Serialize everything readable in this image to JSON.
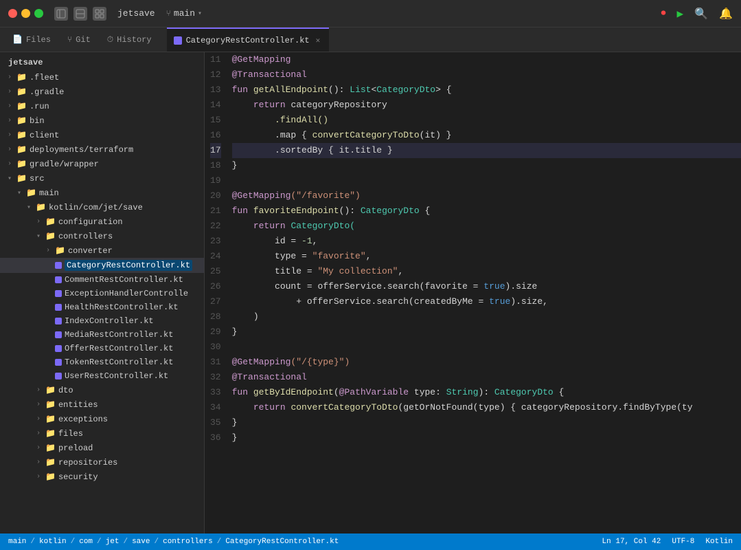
{
  "titlebar": {
    "brand": "jetsave",
    "branch_icon": "⑂",
    "branch": "main",
    "branch_arrow": "▾"
  },
  "tabs": {
    "nav_items": [
      {
        "label": "Files",
        "icon": "📄"
      },
      {
        "label": "Git",
        "icon": "⑂"
      },
      {
        "label": "History",
        "icon": "⏱"
      }
    ],
    "open_file": {
      "name": "CategoryRestController.kt",
      "icon_color": "#7c6af7"
    }
  },
  "sidebar": {
    "root": "jetsave",
    "items": [
      {
        "label": ".fleet",
        "type": "folder",
        "depth": 0,
        "open": false
      },
      {
        "label": ".gradle",
        "type": "folder",
        "depth": 0,
        "open": false
      },
      {
        "label": ".run",
        "type": "folder",
        "depth": 0,
        "open": false
      },
      {
        "label": "bin",
        "type": "folder",
        "depth": 0,
        "open": false
      },
      {
        "label": "client",
        "type": "folder",
        "depth": 0,
        "open": false
      },
      {
        "label": "deployments/terraform",
        "type": "folder",
        "depth": 0,
        "open": false
      },
      {
        "label": "gradle/wrapper",
        "type": "folder",
        "depth": 0,
        "open": false
      },
      {
        "label": "src",
        "type": "folder",
        "depth": 0,
        "open": true
      },
      {
        "label": "main",
        "type": "folder",
        "depth": 1,
        "open": true
      },
      {
        "label": "kotlin/com/jet/save",
        "type": "folder",
        "depth": 2,
        "open": true
      },
      {
        "label": "configuration",
        "type": "folder",
        "depth": 3,
        "open": false
      },
      {
        "label": "controllers",
        "type": "folder",
        "depth": 3,
        "open": true
      },
      {
        "label": "converter",
        "type": "folder",
        "depth": 4,
        "open": false
      },
      {
        "label": "CategoryRestController.kt",
        "type": "file",
        "depth": 4,
        "active": true
      },
      {
        "label": "CommentRestController.kt",
        "type": "file",
        "depth": 4
      },
      {
        "label": "ExceptionHandlerControlle",
        "type": "file",
        "depth": 4
      },
      {
        "label": "HealthRestController.kt",
        "type": "file",
        "depth": 4
      },
      {
        "label": "IndexController.kt",
        "type": "file",
        "depth": 4
      },
      {
        "label": "MediaRestController.kt",
        "type": "file",
        "depth": 4
      },
      {
        "label": "OfferRestController.kt",
        "type": "file",
        "depth": 4
      },
      {
        "label": "TokenRestController.kt",
        "type": "file",
        "depth": 4
      },
      {
        "label": "UserRestController.kt",
        "type": "file",
        "depth": 4
      },
      {
        "label": "dto",
        "type": "folder",
        "depth": 3,
        "open": false
      },
      {
        "label": "entities",
        "type": "folder",
        "depth": 3,
        "open": false
      },
      {
        "label": "exceptions",
        "type": "folder",
        "depth": 3,
        "open": false
      },
      {
        "label": "files",
        "type": "folder",
        "depth": 3,
        "open": false
      },
      {
        "label": "preload",
        "type": "folder",
        "depth": 3,
        "open": false
      },
      {
        "label": "repositories",
        "type": "folder",
        "depth": 3,
        "open": false
      },
      {
        "label": "security",
        "type": "folder",
        "depth": 3,
        "open": false
      }
    ]
  },
  "code": {
    "lines": [
      {
        "num": 11,
        "tokens": [
          {
            "t": "@GetMapping",
            "c": "annot"
          }
        ]
      },
      {
        "num": 12,
        "tokens": [
          {
            "t": "@Transactional",
            "c": "annot"
          }
        ]
      },
      {
        "num": 13,
        "tokens": [
          {
            "t": "fun ",
            "c": "kw"
          },
          {
            "t": "getAllEndpoint",
            "c": "fn"
          },
          {
            "t": "(): ",
            "c": "plain"
          },
          {
            "t": "List",
            "c": "type"
          },
          {
            "t": "<",
            "c": "plain"
          },
          {
            "t": "CategoryDto",
            "c": "type"
          },
          {
            "t": "> {",
            "c": "plain"
          }
        ]
      },
      {
        "num": 14,
        "tokens": [
          {
            "t": "    return ",
            "c": "kw"
          },
          {
            "t": "categoryRepository",
            "c": "plain"
          }
        ]
      },
      {
        "num": 15,
        "tokens": [
          {
            "t": "        .findAll()",
            "c": "fn"
          }
        ]
      },
      {
        "num": 16,
        "tokens": [
          {
            "t": "        .map { ",
            "c": "plain"
          },
          {
            "t": "convertCategoryToDto",
            "c": "fn"
          },
          {
            "t": "(it) }",
            "c": "plain"
          }
        ]
      },
      {
        "num": 17,
        "tokens": [
          {
            "t": "        .sortedBy { it.title }",
            "c": "plain"
          }
        ],
        "highlight": true
      },
      {
        "num": 18,
        "tokens": [
          {
            "t": "}",
            "c": "plain"
          }
        ]
      },
      {
        "num": 19,
        "tokens": []
      },
      {
        "num": 20,
        "tokens": [
          {
            "t": "@GetMapping",
            "c": "annot"
          },
          {
            "t": "(\"/favorite\")",
            "c": "str"
          }
        ]
      },
      {
        "num": 21,
        "tokens": [
          {
            "t": "fun ",
            "c": "kw"
          },
          {
            "t": "favoriteEndpoint",
            "c": "fn"
          },
          {
            "t": "(): ",
            "c": "plain"
          },
          {
            "t": "CategoryDto",
            "c": "type"
          },
          {
            "t": " {",
            "c": "plain"
          }
        ]
      },
      {
        "num": 22,
        "tokens": [
          {
            "t": "    return ",
            "c": "kw"
          },
          {
            "t": "CategoryDto(",
            "c": "type"
          }
        ]
      },
      {
        "num": 23,
        "tokens": [
          {
            "t": "        id = ",
            "c": "plain"
          },
          {
            "t": "-1",
            "c": "num"
          },
          {
            "t": ",",
            "c": "plain"
          }
        ]
      },
      {
        "num": 24,
        "tokens": [
          {
            "t": "        type = ",
            "c": "plain"
          },
          {
            "t": "\"favorite\"",
            "c": "str"
          },
          {
            "t": ",",
            "c": "plain"
          }
        ]
      },
      {
        "num": 25,
        "tokens": [
          {
            "t": "        title = ",
            "c": "plain"
          },
          {
            "t": "\"My collection\"",
            "c": "str"
          },
          {
            "t": ",",
            "c": "plain"
          }
        ]
      },
      {
        "num": 26,
        "tokens": [
          {
            "t": "        count = ",
            "c": "plain"
          },
          {
            "t": "offerService",
            "c": "plain"
          },
          {
            "t": ".search(favorite = ",
            "c": "plain"
          },
          {
            "t": "true",
            "c": "bool"
          },
          {
            "t": ").size",
            "c": "plain"
          }
        ]
      },
      {
        "num": 27,
        "tokens": [
          {
            "t": "            + ",
            "c": "plain"
          },
          {
            "t": "offerService",
            "c": "plain"
          },
          {
            "t": ".search(createdByMe = ",
            "c": "plain"
          },
          {
            "t": "true",
            "c": "bool"
          },
          {
            "t": ").size,",
            "c": "plain"
          }
        ]
      },
      {
        "num": 28,
        "tokens": [
          {
            "t": "    )",
            "c": "plain"
          }
        ]
      },
      {
        "num": 29,
        "tokens": [
          {
            "t": "}",
            "c": "plain"
          }
        ]
      },
      {
        "num": 30,
        "tokens": []
      },
      {
        "num": 31,
        "tokens": [
          {
            "t": "@GetMapping",
            "c": "annot"
          },
          {
            "t": "(\"/{type}\")",
            "c": "str"
          }
        ]
      },
      {
        "num": 32,
        "tokens": [
          {
            "t": "@Transactional",
            "c": "annot"
          }
        ]
      },
      {
        "num": 33,
        "tokens": [
          {
            "t": "fun ",
            "c": "kw"
          },
          {
            "t": "getByIdEndpoint",
            "c": "fn"
          },
          {
            "t": "(",
            "c": "plain"
          },
          {
            "t": "@PathVariable",
            "c": "annot"
          },
          {
            "t": " type: ",
            "c": "plain"
          },
          {
            "t": "String",
            "c": "type"
          },
          {
            "t": "): ",
            "c": "plain"
          },
          {
            "t": "CategoryDto",
            "c": "type"
          },
          {
            "t": " {",
            "c": "plain"
          }
        ]
      },
      {
        "num": 34,
        "tokens": [
          {
            "t": "    return ",
            "c": "kw"
          },
          {
            "t": "convertCategoryToDto",
            "c": "fn"
          },
          {
            "t": "(getOrNotFound(type) { categoryRepository.findByType(ty",
            "c": "plain"
          }
        ]
      },
      {
        "num": 35,
        "tokens": [
          {
            "t": "}",
            "c": "plain"
          }
        ]
      },
      {
        "num": 36,
        "tokens": [
          {
            "t": "}",
            "c": "plain"
          }
        ]
      }
    ]
  },
  "statusbar": {
    "breadcrumb": [
      "main",
      "kotlin",
      "com",
      "jet",
      "save",
      "controllers",
      "CategoryRestController.kt"
    ],
    "position": "Ln 17, Col 42",
    "encoding": "UTF-8",
    "language": "Kotlin"
  }
}
